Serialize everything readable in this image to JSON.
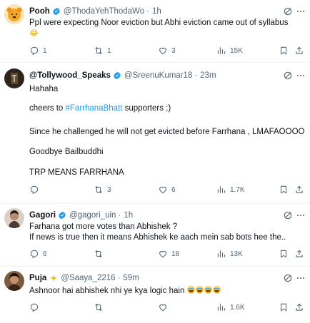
{
  "tweets": [
    {
      "name": "Pooh",
      "handle": "@ThodaYehThodaWo",
      "dot": "·",
      "time": "1h",
      "lines": [
        "Ppl were expecting Noor eviction but Abhi eviction came out of syllabus"
      ],
      "trailing_emoji": "😂",
      "replies": "1",
      "reposts": "1",
      "likes": "3",
      "views": "15K",
      "avatar_color": "#f5a623"
    },
    {
      "name": "@Tollywood_Speaks",
      "handle": "@SreenuKumar18",
      "dot": "·",
      "time": "23m",
      "line1": "Hahaha",
      "line2_prefix": "cheers to ",
      "line2_hashtag": "#FarrhanaBhatt",
      "line2_suffix": " supporters ;)",
      "line3": "Since he challenged he will not get evicted before Farrhana , LMAFAOOOO",
      "line4": "Goodbye Bailbuddhi",
      "line5": "TRP MEANS FARRHANA",
      "replies": "",
      "reposts": "3",
      "likes": "6",
      "views": "1.7K",
      "avatar_color": "#3b2f24"
    },
    {
      "name": "Gagori",
      "handle": "@gagori_uin",
      "dot": "·",
      "time": "1h",
      "lines": [
        "Farhana got more votes than Abhishek ?",
        "If news is true then it means Abhishek ke aach mein sab bots hee the.."
      ],
      "replies": "6",
      "reposts": "",
      "likes": "18",
      "views": "13K",
      "avatar_color": "#8a6a55"
    },
    {
      "name": "Puja",
      "handle": "@Saaya_2216",
      "dot": "·",
      "time": "59m",
      "lines": [
        "Ashnoor hai abhishek nhi ye kya logic hain"
      ],
      "emoji_count": 4,
      "replies": "",
      "reposts": "",
      "likes": "",
      "views": "1.6K",
      "avatar_color": "#5a3e2b"
    }
  ],
  "icons": {
    "reply": "reply-icon",
    "repost": "repost-icon",
    "like": "heart-icon",
    "views": "views-icon",
    "bookmark": "bookmark-icon",
    "share": "share-icon",
    "grok": "grok-icon",
    "more": "more-icon",
    "verified": "verified-badge-icon"
  },
  "colors": {
    "text": "#0f1419",
    "muted": "#536471",
    "link": "#1d9bf0",
    "verified": "#1d9bf0",
    "divider": "#eff3f4"
  }
}
